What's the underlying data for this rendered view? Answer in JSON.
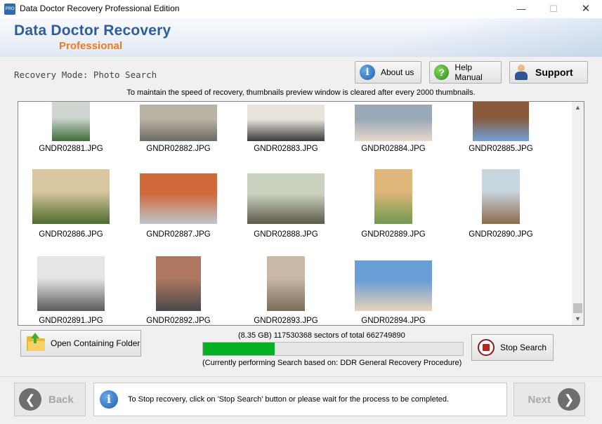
{
  "window": {
    "title": "Data Doctor Recovery Professional Edition",
    "app_icon_text": "PRO",
    "minimize_glyph": "—",
    "maximize_glyph": "☐",
    "close_glyph": "✕"
  },
  "header": {
    "brand_main": "Data Doctor Recovery",
    "brand_sub": "Professional"
  },
  "mode": {
    "label": "Recovery Mode: Photo Search"
  },
  "buttons": {
    "about": "About us",
    "help": "Help Manual",
    "support": "Support",
    "open_folder": "Open Containing Folder",
    "stop_search": "Stop Search",
    "back": "Back",
    "next": "Next"
  },
  "notice": "To maintain the speed of recovery, thumbnails preview window is cleared after every 2000 thumbnails.",
  "gallery": {
    "rows": [
      [
        {
          "name": "GNDR02881.JPG"
        },
        {
          "name": "GNDR02882.JPG"
        },
        {
          "name": "GNDR02883.JPG"
        },
        {
          "name": "GNDR02884.JPG"
        },
        {
          "name": "GNDR02885.JPG"
        }
      ],
      [
        {
          "name": "GNDR02886.JPG"
        },
        {
          "name": "GNDR02887.JPG"
        },
        {
          "name": "GNDR02888.JPG"
        },
        {
          "name": "GNDR02889.JPG"
        },
        {
          "name": "GNDR02890.JPG"
        }
      ],
      [
        {
          "name": "GNDR02891.JPG"
        },
        {
          "name": "GNDR02892.JPG"
        },
        {
          "name": "GNDR02893.JPG"
        },
        {
          "name": "GNDR02894.JPG"
        }
      ]
    ]
  },
  "progress": {
    "sector_text": "(8.35 GB) 117530368  sectors  of  total 662749890",
    "fraction": 0.2765,
    "procedure_text": "(Currently performing Search based on:  DDR General Recovery Procedure)"
  },
  "footer": {
    "message": "To Stop recovery, click on 'Stop Search' button or please wait for the process to be completed."
  },
  "colors": {
    "brand_blue": "#2e5d9e",
    "brand_orange": "#f07a1e",
    "progress_green": "#06b025"
  },
  "icons": {
    "about": "info-icon",
    "help": "question-icon",
    "support": "support-person-icon",
    "open_folder": "folder-icon",
    "stop": "stop-icon",
    "back": "arrow-left-icon",
    "next": "arrow-right-icon"
  }
}
